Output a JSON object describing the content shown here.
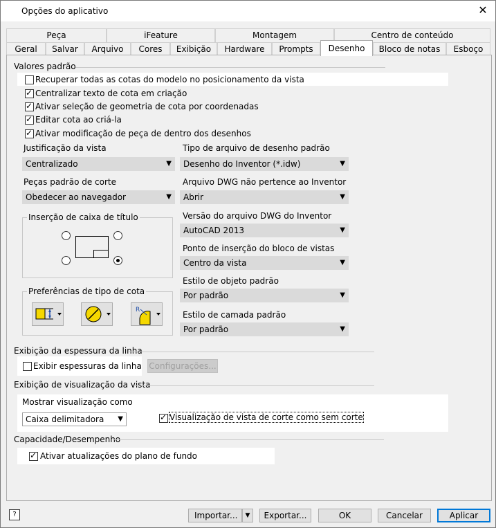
{
  "window": {
    "title": "Opções do aplicativo",
    "close_label": "✕"
  },
  "tabs_row1": [
    "Peça",
    "iFeature",
    "Montagem",
    "Centro de conteúdo"
  ],
  "tabs_row2": [
    "Geral",
    "Salvar",
    "Arquivo",
    "Cores",
    "Exibição",
    "Hardware",
    "Prompts",
    "Desenho",
    "Bloco de notas",
    "Esboço"
  ],
  "active_tab": "Desenho",
  "defaults": {
    "section_label": "Valores padrão",
    "checkboxes": [
      {
        "label": "Recuperar todas as cotas do modelo no posicionamento da vista",
        "checked": false
      },
      {
        "label": "Centralizar texto de cota em criação",
        "checked": true
      },
      {
        "label": "Ativar seleção de geometria de cota por coordenadas",
        "checked": true
      },
      {
        "label": "Editar cota ao criá-la",
        "checked": true
      },
      {
        "label": "Ativar modificação de peça de dentro dos desenhos",
        "checked": true
      }
    ],
    "view_justification": {
      "label": "Justificação da vista",
      "value": "Centralizado"
    },
    "section_parts": {
      "label": "Peças padrão de corte",
      "value": "Obedecer ao navegador"
    },
    "title_block_insertion": {
      "label": "Inserção de caixa de título"
    },
    "dim_type_prefs": {
      "label": "Preferências de tipo de cota"
    },
    "default_file_type": {
      "label": "Tipo de arquivo de desenho padrão",
      "value": "Desenho do Inventor (*.idw)"
    },
    "non_inventor_dwg": {
      "label": "Arquivo DWG não pertence ao Inventor",
      "value": "Abrir"
    },
    "dwg_version": {
      "label": "Versão do arquivo DWG do Inventor",
      "value": "AutoCAD 2013"
    },
    "view_block_insertion": {
      "label": "Ponto de inserção do bloco de vistas",
      "value": "Centro da vista"
    },
    "default_object_style": {
      "label": "Estilo de objeto padrão",
      "value": "Por padrão"
    },
    "default_layer_style": {
      "label": "Estilo de camada padrão",
      "value": "Por padrão"
    }
  },
  "line_weight": {
    "section_label": "Exibição da espessura da linha",
    "checkbox": {
      "label": "Exibir espessuras da linha",
      "checked": false
    },
    "settings_button": "Configurações..."
  },
  "view_preview": {
    "section_label": "Exibição de visualização da vista",
    "show_as_label": "Mostrar visualização como",
    "show_as_value": "Caixa delimitadora",
    "section_checkbox": {
      "label": "Visualização de vista de corte como sem corte",
      "checked": true
    }
  },
  "capacity": {
    "section_label": "Capacidade/Desempenho",
    "checkbox": {
      "label": "Ativar atualizações do plano de fundo",
      "checked": true
    }
  },
  "footer": {
    "help_icon": "?",
    "import_label": "Importar...",
    "export_label": "Exportar...",
    "ok_label": "OK",
    "cancel_label": "Cancelar",
    "apply_label": "Aplicar"
  },
  "colors": {
    "accent": "#0078d7",
    "dim_icon_yellow": "#f5d800",
    "dim_icon_blue": "#1f4ea8"
  }
}
